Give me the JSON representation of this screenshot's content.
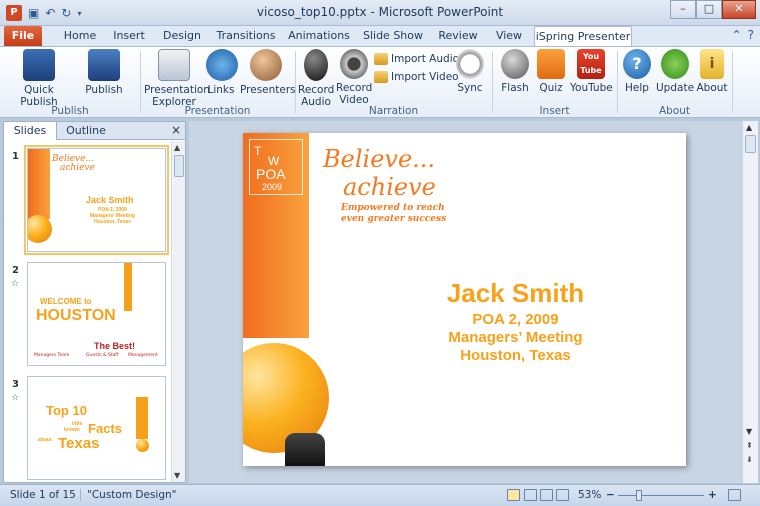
{
  "window": {
    "title": "vicoso_top10.pptx - Microsoft PowerPoint",
    "app_icon": "P",
    "minimize": "–",
    "maximize": "□",
    "close": "✕"
  },
  "tabs": [
    {
      "label": "File"
    },
    {
      "label": "Home"
    },
    {
      "label": "Insert"
    },
    {
      "label": "Design"
    },
    {
      "label": "Transitions"
    },
    {
      "label": "Animations"
    },
    {
      "label": "Slide Show"
    },
    {
      "label": "Review"
    },
    {
      "label": "View"
    },
    {
      "label": "iSpring Presenter"
    }
  ],
  "ribbon": {
    "publish": {
      "group": "Publish",
      "quick_publish": "Quick Publish",
      "publish": "Publish"
    },
    "presentation": {
      "group": "Presentation",
      "explorer": "Presentation Explorer",
      "explorer_l1": "Presentation",
      "explorer_l2": "Explorer",
      "links": "Links",
      "presenters": "Presenters"
    },
    "narration": {
      "group": "Narration",
      "record_audio_l1": "Record",
      "record_audio_l2": "Audio",
      "record_video_l1": "Record",
      "record_video_l2": "Video",
      "import_audio": "Import Audio",
      "import_video": "Import Video",
      "sync": "Sync"
    },
    "insert": {
      "group": "Insert",
      "flash": "Flash",
      "quiz": "Quiz",
      "youtube": "YouTube",
      "youtube_logo": "You Tube"
    },
    "about": {
      "group": "About",
      "help": "Help",
      "update": "Update",
      "about": "About"
    }
  },
  "left_pane": {
    "tab_slides": "Slides",
    "tab_outline": "Outline",
    "close": "×",
    "slides": [
      {
        "num": "1",
        "title": "Jack Smith",
        "l1": "POA 2, 2009",
        "l2": "Managers' Meeting",
        "l3": "Houston, Texas",
        "b1": "Believe...",
        "b2": "achieve"
      },
      {
        "num": "2",
        "welcome": "WELCOME to",
        "houston": "HOUSTON",
        "best": "The Best!",
        "footer_left": "Managers Team",
        "footer_mid": "Guests & Staff",
        "footer_right": "Management"
      },
      {
        "num": "3",
        "top10": "Top 10",
        "little": "little",
        "known": "known",
        "facts": "Facts",
        "about": "about",
        "texas": "Texas"
      }
    ]
  },
  "slide": {
    "year_box_t": "T",
    "year_box_w": "W",
    "year_box_poa": "POA",
    "year_box_year": "2009",
    "believe": "Believe...",
    "achieve": "achieve",
    "tagline_1": "Empowered to reach",
    "tagline_2": "even greater success",
    "name": "Jack Smith",
    "line1": "POA 2, 2009",
    "line2": "Managers’ Meeting",
    "line3": "Houston, Texas"
  },
  "status": {
    "slide_pos": "Slide 1 of 15",
    "theme": "\"Custom Design\"",
    "zoom": "53%",
    "zoom_out": "−",
    "zoom_in": "+"
  },
  "colors": {
    "accent_orange": "#f37a1f",
    "file_tab": "#d24726",
    "title_text": "#f7a21a"
  }
}
